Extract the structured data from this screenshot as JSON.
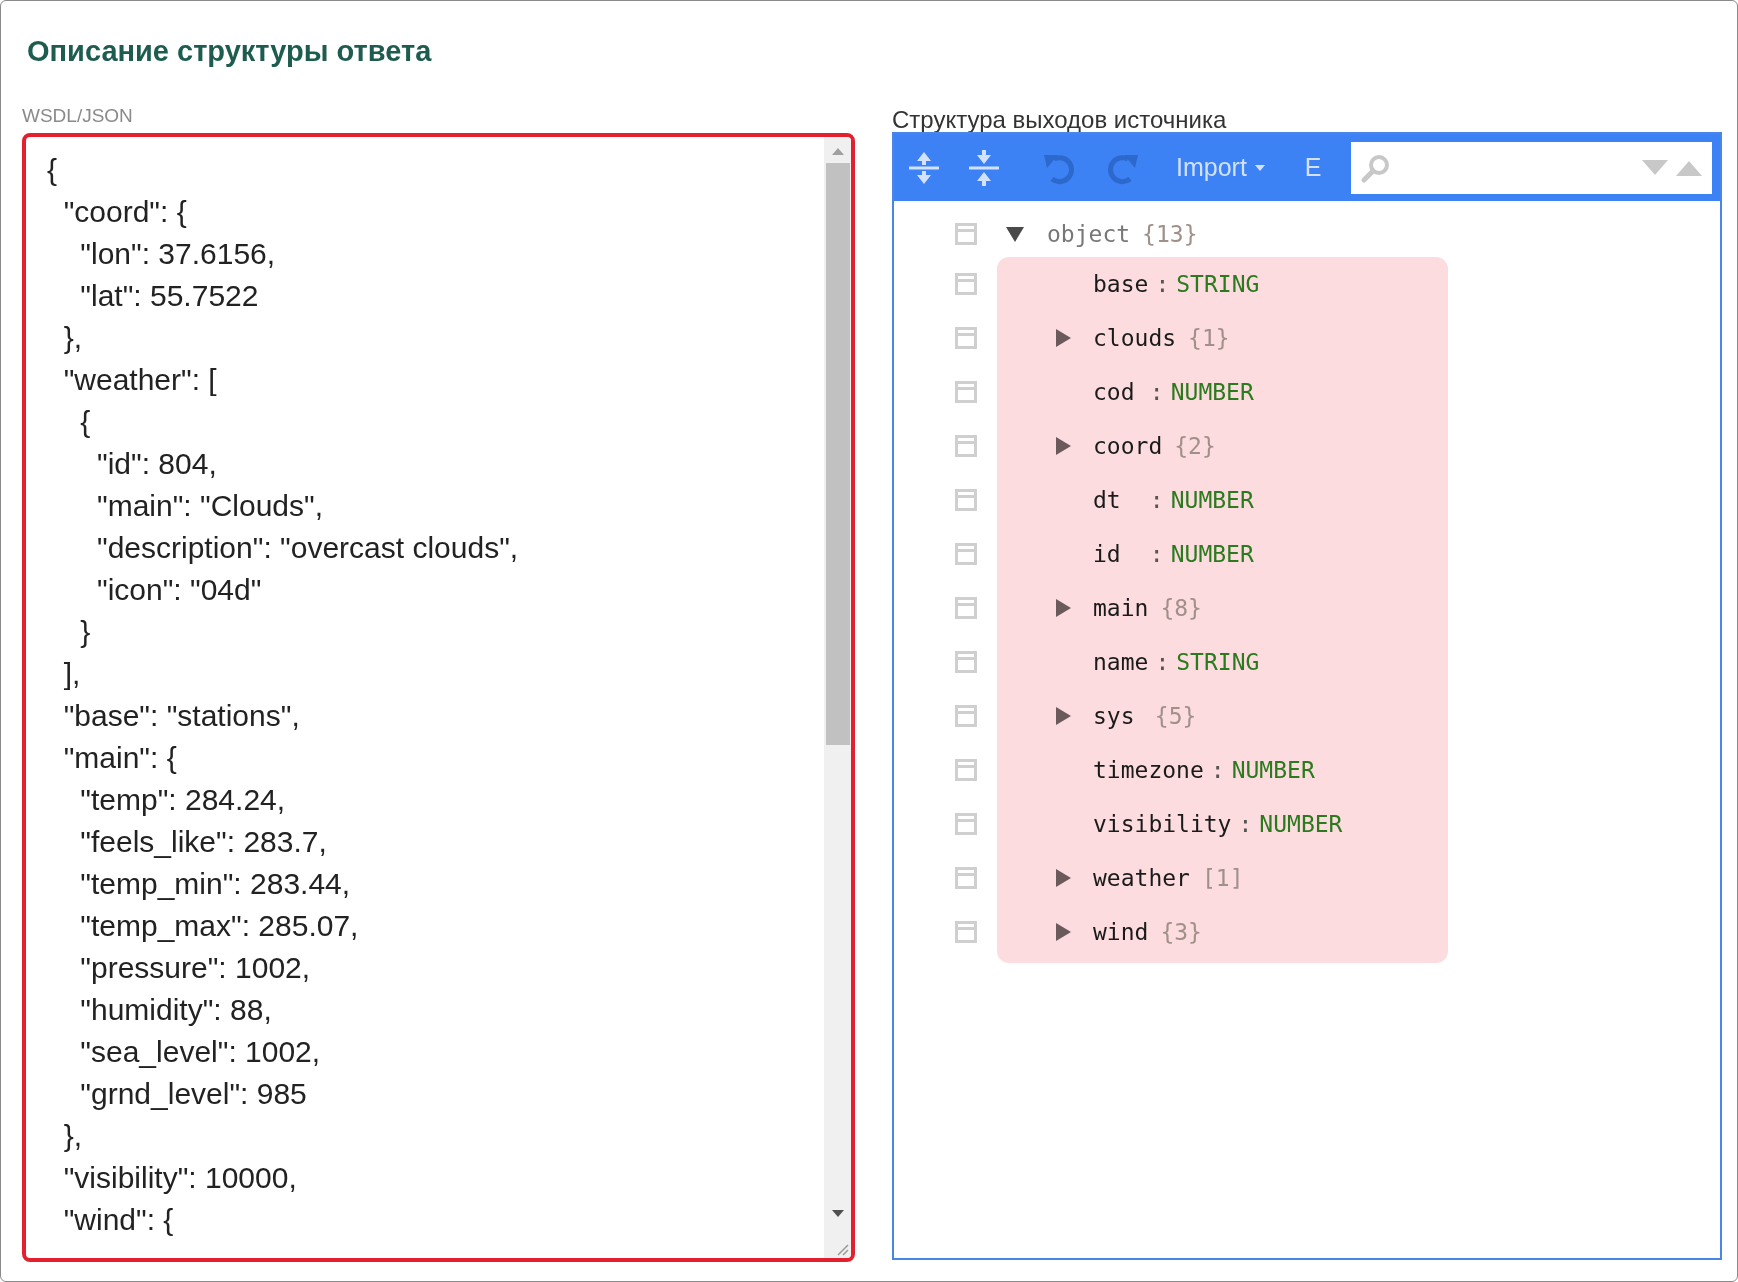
{
  "title": "Описание структуры ответа",
  "source": {
    "label": "WSDL/JSON",
    "lines": [
      "{",
      "  \"coord\": {",
      "    \"lon\": 37.6156,",
      "    \"lat\": 55.7522",
      "  },",
      "  \"weather\": [",
      "    {",
      "      \"id\": 804,",
      "      \"main\": \"Clouds\",",
      "      \"description\": \"overcast clouds\",",
      "      \"icon\": \"04d\"",
      "    }",
      "  ],",
      "  \"base\": \"stations\",",
      "  \"main\": {",
      "    \"temp\": 284.24,",
      "    \"feels_like\": 283.7,",
      "    \"temp_min\": 283.44,",
      "    \"temp_max\": 285.07,",
      "    \"pressure\": 1002,",
      "    \"humidity\": 88,",
      "    \"sea_level\": 1002,",
      "    \"grnd_level\": 985",
      "  },",
      "  \"visibility\": 10000,",
      "  \"wind\": {"
    ]
  },
  "structure": {
    "label": "Структура выходов источника",
    "toolbar": [
      {
        "kind": "expand",
        "disabled": false
      },
      {
        "kind": "collapse",
        "disabled": false
      },
      {
        "kind": "undo",
        "disabled": true
      },
      {
        "kind": "redo",
        "disabled": true
      },
      {
        "kind": "menu",
        "label": "Import"
      },
      {
        "kind": "text",
        "label": "E"
      }
    ],
    "tree": {
      "name": "object",
      "count": "{13}",
      "expanded": true,
      "children": [
        {
          "kind": "leaf",
          "name": "base",
          "colon": ":",
          "type": "STRING"
        },
        {
          "kind": "branch",
          "name": "clouds",
          "count": "{1}",
          "expanded": false
        },
        {
          "kind": "leaf",
          "name": "cod",
          "colon": ":",
          "type": "NUMBER"
        },
        {
          "kind": "branch",
          "name": "coord",
          "count": "{2}",
          "expanded": false
        },
        {
          "kind": "leaf",
          "name": "dt",
          "colon": ":",
          "type": "NUMBER"
        },
        {
          "kind": "leaf",
          "name": "id",
          "colon": ":",
          "type": "NUMBER"
        },
        {
          "kind": "branch",
          "name": "main",
          "count": "{8}",
          "expanded": false
        },
        {
          "kind": "leaf",
          "name": "name",
          "colon": ":",
          "type": "STRING"
        },
        {
          "kind": "branch",
          "name": "sys",
          "count": "{5}",
          "expanded": false
        },
        {
          "kind": "leaf",
          "name": "timezone",
          "colon": ":",
          "type": "NUMBER"
        },
        {
          "kind": "leaf",
          "name": "visibility",
          "colon": ":",
          "type": "NUMBER"
        },
        {
          "kind": "branch",
          "name": "weather",
          "count": "[1]",
          "expanded": false
        },
        {
          "kind": "branch",
          "name": "wind",
          "count": "{3}",
          "expanded": false
        }
      ]
    }
  }
}
